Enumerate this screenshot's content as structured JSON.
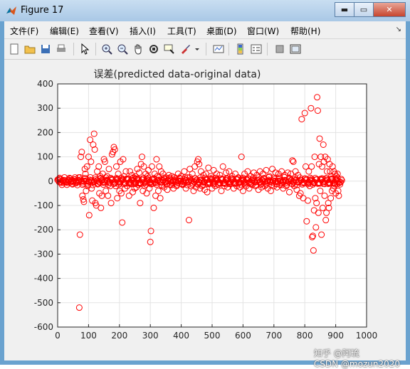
{
  "window": {
    "title": "Figure 17",
    "buttons": {
      "minimize": "▬",
      "maximize": "▭",
      "close": "✕"
    }
  },
  "menu": {
    "items": [
      "文件(F)",
      "编辑(E)",
      "查看(V)",
      "插入(I)",
      "工具(T)",
      "桌面(D)",
      "窗口(W)",
      "帮助(H)"
    ],
    "extra": "↘"
  },
  "toolbar": {
    "icons": [
      "new-figure-icon",
      "open-file-icon",
      "save-icon",
      "print-icon",
      "pointer-icon",
      "zoom-in-icon",
      "zoom-out-icon",
      "pan-hand-icon",
      "rotate-3d-icon",
      "data-cursor-icon",
      "brush-icon",
      "brush-dropdown-icon",
      "link-plot-icon",
      "colorbar-icon",
      "legend-icon",
      "hide-plot-tools-icon",
      "show-plot-tools-icon"
    ]
  },
  "watermark": "知乎 @阿琉",
  "watermark2": "CSDN @mozun2020",
  "chart_data": {
    "type": "scatter",
    "title": "误差(predicted data-original data)",
    "xlabel": "",
    "ylabel": "",
    "xlim": [
      0,
      1000
    ],
    "ylim": [
      -600,
      400
    ],
    "xticks": [
      0,
      100,
      200,
      300,
      400,
      500,
      600,
      700,
      800,
      900,
      1000
    ],
    "yticks": [
      400,
      300,
      200,
      100,
      0,
      -100,
      -200,
      -300,
      -400,
      -500,
      -600
    ],
    "grid": true,
    "marker": "open circle",
    "color": "#ff0000",
    "series": [
      {
        "name": "",
        "points": [
          [
            0,
            5
          ],
          [
            5,
            -4
          ],
          [
            10,
            8
          ],
          [
            15,
            2
          ],
          [
            20,
            -6
          ],
          [
            25,
            3
          ],
          [
            30,
            -2
          ],
          [
            35,
            6
          ],
          [
            40,
            -5
          ],
          [
            45,
            4
          ],
          [
            50,
            -3
          ],
          [
            55,
            7
          ],
          [
            60,
            -8
          ],
          [
            65,
            5
          ],
          [
            68,
            15
          ],
          [
            70,
            -520
          ],
          [
            72,
            -220
          ],
          [
            75,
            100
          ],
          [
            78,
            120
          ],
          [
            80,
            -60
          ],
          [
            83,
            -75
          ],
          [
            85,
            -85
          ],
          [
            88,
            50
          ],
          [
            90,
            30
          ],
          [
            92,
            -40
          ],
          [
            95,
            60
          ],
          [
            97,
            -20
          ],
          [
            100,
            100
          ],
          [
            102,
            -140
          ],
          [
            105,
            170
          ],
          [
            108,
            80
          ],
          [
            110,
            -30
          ],
          [
            112,
            -80
          ],
          [
            115,
            150
          ],
          [
            118,
            195
          ],
          [
            120,
            130
          ],
          [
            122,
            -90
          ],
          [
            125,
            -100
          ],
          [
            128,
            40
          ],
          [
            130,
            -10
          ],
          [
            133,
            60
          ],
          [
            135,
            -50
          ],
          [
            138,
            20
          ],
          [
            140,
            -110
          ],
          [
            143,
            -60
          ],
          [
            146,
            30
          ],
          [
            150,
            90
          ],
          [
            153,
            80
          ],
          [
            156,
            -40
          ],
          [
            160,
            20
          ],
          [
            163,
            -60
          ],
          [
            166,
            50
          ],
          [
            170,
            -20
          ],
          [
            173,
            -90
          ],
          [
            176,
            110
          ],
          [
            179,
            120
          ],
          [
            182,
            140
          ],
          [
            185,
            130
          ],
          [
            188,
            -20
          ],
          [
            190,
            60
          ],
          [
            193,
            -70
          ],
          [
            196,
            30
          ],
          [
            200,
            -40
          ],
          [
            203,
            80
          ],
          [
            206,
            -50
          ],
          [
            209,
            -170
          ],
          [
            212,
            90
          ],
          [
            215,
            20
          ],
          [
            218,
            -30
          ],
          [
            221,
            40
          ],
          [
            225,
            -20
          ],
          [
            228,
            10
          ],
          [
            231,
            -60
          ],
          [
            234,
            40
          ],
          [
            237,
            -10
          ],
          [
            240,
            25
          ],
          [
            243,
            -45
          ],
          [
            246,
            15
          ],
          [
            249,
            -30
          ],
          [
            252,
            20
          ],
          [
            255,
            -25
          ],
          [
            258,
            50
          ],
          [
            261,
            -15
          ],
          [
            264,
            35
          ],
          [
            267,
            -90
          ],
          [
            270,
            70
          ],
          [
            273,
            100
          ],
          [
            276,
            -40
          ],
          [
            279,
            60
          ],
          [
            282,
            -20
          ],
          [
            285,
            30
          ],
          [
            288,
            -50
          ],
          [
            291,
            20
          ],
          [
            294,
            45
          ],
          [
            297,
            -30
          ],
          [
            300,
            -250
          ],
          [
            302,
            -205
          ],
          [
            305,
            60
          ],
          [
            308,
            -10
          ],
          [
            311,
            -110
          ],
          [
            314,
            30
          ],
          [
            317,
            -60
          ],
          [
            320,
            90
          ],
          [
            323,
            20
          ],
          [
            326,
            -40
          ],
          [
            329,
            60
          ],
          [
            332,
            -70
          ],
          [
            335,
            40
          ],
          [
            338,
            -20
          ],
          [
            341,
            30
          ],
          [
            345,
            -25
          ],
          [
            350,
            15
          ],
          [
            355,
            -35
          ],
          [
            360,
            25
          ],
          [
            365,
            -15
          ],
          [
            370,
            20
          ],
          [
            375,
            -30
          ],
          [
            380,
            10
          ],
          [
            385,
            -20
          ],
          [
            390,
            30
          ],
          [
            395,
            -10
          ],
          [
            400,
            20
          ],
          [
            405,
            -15
          ],
          [
            410,
            40
          ],
          [
            415,
            -30
          ],
          [
            420,
            15
          ],
          [
            425,
            -160
          ],
          [
            428,
            50
          ],
          [
            432,
            -20
          ],
          [
            436,
            30
          ],
          [
            440,
            -40
          ],
          [
            444,
            60
          ],
          [
            448,
            -25
          ],
          [
            452,
            80
          ],
          [
            455,
            90
          ],
          [
            458,
            70
          ],
          [
            461,
            -30
          ],
          [
            464,
            40
          ],
          [
            468,
            -20
          ],
          [
            472,
            25
          ],
          [
            476,
            -35
          ],
          [
            480,
            30
          ],
          [
            484,
            -45
          ],
          [
            488,
            55
          ],
          [
            492,
            -10
          ],
          [
            496,
            20
          ],
          [
            500,
            -30
          ],
          [
            505,
            45
          ],
          [
            510,
            -20
          ],
          [
            515,
            30
          ],
          [
            520,
            -15
          ],
          [
            525,
            25
          ],
          [
            530,
            -40
          ],
          [
            535,
            60
          ],
          [
            540,
            -20
          ],
          [
            545,
            35
          ],
          [
            550,
            -25
          ],
          [
            555,
            40
          ],
          [
            560,
            -10
          ],
          [
            565,
            20
          ],
          [
            570,
            -30
          ],
          [
            575,
            30
          ],
          [
            580,
            -20
          ],
          [
            585,
            15
          ],
          [
            590,
            -25
          ],
          [
            595,
            100
          ],
          [
            600,
            -40
          ],
          [
            605,
            30
          ],
          [
            610,
            -20
          ],
          [
            615,
            40
          ],
          [
            620,
            -30
          ],
          [
            625,
            20
          ],
          [
            630,
            -15
          ],
          [
            635,
            35
          ],
          [
            640,
            -20
          ],
          [
            645,
            25
          ],
          [
            650,
            -35
          ],
          [
            655,
            40
          ],
          [
            660,
            -25
          ],
          [
            665,
            30
          ],
          [
            670,
            -20
          ],
          [
            675,
            45
          ],
          [
            680,
            -30
          ],
          [
            685,
            20
          ],
          [
            690,
            -40
          ],
          [
            695,
            50
          ],
          [
            700,
            -20
          ],
          [
            705,
            35
          ],
          [
            710,
            -25
          ],
          [
            715,
            30
          ],
          [
            720,
            -15
          ],
          [
            725,
            40
          ],
          [
            730,
            -30
          ],
          [
            735,
            25
          ],
          [
            740,
            -20
          ],
          [
            745,
            35
          ],
          [
            750,
            -45
          ],
          [
            755,
            30
          ],
          [
            760,
            85
          ],
          [
            763,
            80
          ],
          [
            766,
            -20
          ],
          [
            770,
            40
          ],
          [
            774,
            -35
          ],
          [
            778,
            25
          ],
          [
            782,
            -60
          ],
          [
            786,
            -50
          ],
          [
            790,
            255
          ],
          [
            795,
            -70
          ],
          [
            800,
            280
          ],
          [
            803,
            60
          ],
          [
            806,
            -165
          ],
          [
            810,
            -80
          ],
          [
            813,
            40
          ],
          [
            816,
            -20
          ],
          [
            820,
            300
          ],
          [
            822,
            60
          ],
          [
            824,
            -230
          ],
          [
            826,
            -225
          ],
          [
            828,
            -285
          ],
          [
            830,
            -120
          ],
          [
            832,
            100
          ],
          [
            834,
            -70
          ],
          [
            836,
            -190
          ],
          [
            838,
            -90
          ],
          [
            840,
            345
          ],
          [
            842,
            290
          ],
          [
            844,
            -130
          ],
          [
            846,
            70
          ],
          [
            848,
            175
          ],
          [
            850,
            -40
          ],
          [
            852,
            100
          ],
          [
            854,
            -220
          ],
          [
            856,
            60
          ],
          [
            858,
            -110
          ],
          [
            860,
            150
          ],
          [
            862,
            80
          ],
          [
            864,
            -60
          ],
          [
            866,
            100
          ],
          [
            868,
            -160
          ],
          [
            870,
            -130
          ],
          [
            872,
            40
          ],
          [
            874,
            90
          ],
          [
            876,
            -90
          ],
          [
            878,
            -110
          ],
          [
            880,
            70
          ],
          [
            882,
            40
          ],
          [
            884,
            -70
          ],
          [
            886,
            20
          ],
          [
            888,
            -40
          ],
          [
            890,
            60
          ],
          [
            892,
            -30
          ],
          [
            894,
            40
          ],
          [
            896,
            -20
          ],
          [
            898,
            30
          ],
          [
            900,
            -50
          ],
          [
            902,
            20
          ],
          [
            904,
            -10
          ],
          [
            906,
            30
          ],
          [
            908,
            -40
          ],
          [
            910,
            -60
          ]
        ]
      }
    ]
  }
}
